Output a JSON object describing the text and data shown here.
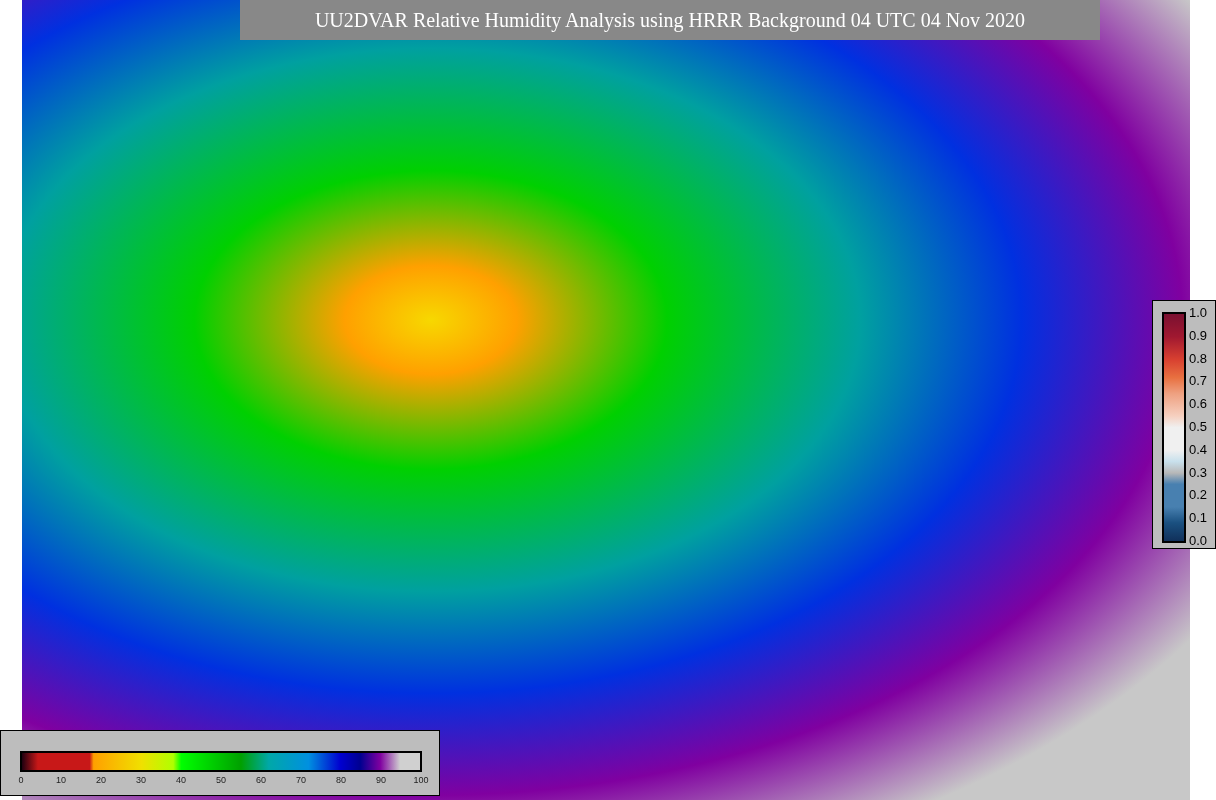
{
  "title": "UU2DVAR Relative Humidity Analysis using HRRR Background 04 UTC 04 Nov 2020",
  "humidity_colorbar": {
    "ticks": [
      "0",
      "10",
      "20",
      "30",
      "40",
      "50",
      "60",
      "70",
      "80",
      "90",
      "100"
    ]
  },
  "observation_colorbar": {
    "ticks": [
      "1.0",
      "0.9",
      "0.8",
      "0.7",
      "0.6",
      "0.5",
      "0.4",
      "0.3",
      "0.2",
      "0.1",
      "0.0"
    ]
  }
}
